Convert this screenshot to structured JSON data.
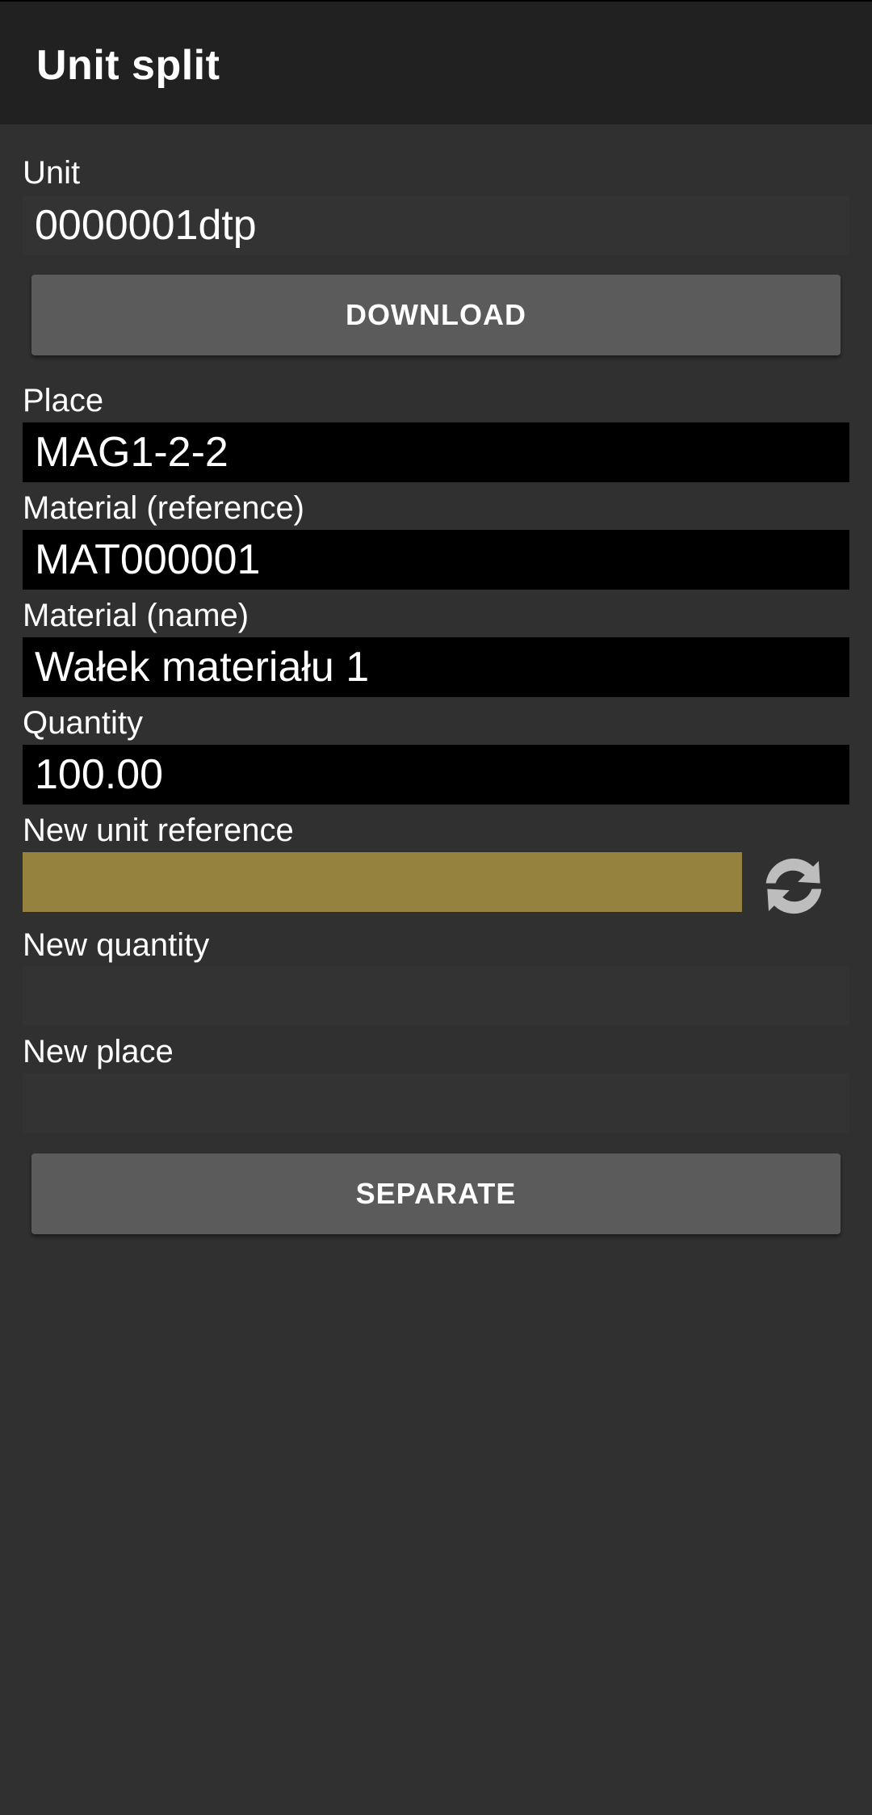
{
  "app": {
    "title": "Unit split"
  },
  "form": {
    "unit": {
      "label": "Unit",
      "value": "0000001dtp"
    },
    "download_button": "DOWNLOAD",
    "place": {
      "label": "Place",
      "value": "MAG1-2-2"
    },
    "material_reference": {
      "label": "Material (reference)",
      "value": "MAT000001"
    },
    "material_name": {
      "label": "Material (name)",
      "value": "Wałek materiału 1"
    },
    "quantity": {
      "label": "Quantity",
      "value": "100.00"
    },
    "new_unit_reference": {
      "label": "New unit reference",
      "value": ""
    },
    "new_quantity": {
      "label": "New quantity",
      "value": ""
    },
    "new_place": {
      "label": "New place",
      "value": ""
    },
    "separate_button": "SEPARATE"
  },
  "icons": {
    "refresh": "refresh-icon"
  },
  "colors": {
    "background": "#303030",
    "app_bar": "#212121",
    "readonly_field": "#000000",
    "highlight_field": "#96823f",
    "button": "#5b5b5c"
  }
}
